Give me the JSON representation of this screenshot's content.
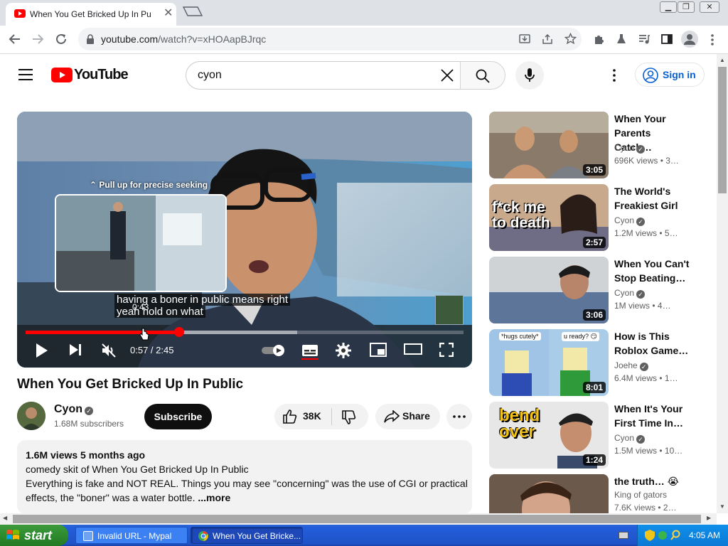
{
  "browser": {
    "tab_title": "When You Get Bricked Up In Public",
    "tab_close": "✕",
    "url_host": "youtube.com",
    "url_path": "/watch?v=xHOAapBJrqc"
  },
  "yt": {
    "logo_text": "YouTube",
    "search_value": "cyon",
    "signin_label": "Sign in"
  },
  "player": {
    "pull_up_hint": "Pull up for precise seeking",
    "subtitle_line1": "having a boner in public means right",
    "subtitle_line2": "yeah hold on what",
    "hover_time": "0:43",
    "time_display": "0:57 / 2:45",
    "progress": 0.35,
    "buffered": 0.62
  },
  "video": {
    "title": "When You Get Bricked Up In Public",
    "channel": "Cyon",
    "subscribers": "1.68M subscribers",
    "subscribe_label": "Subscribe",
    "likes": "38K",
    "share_label": "Share",
    "desc_stats": "1.6M views  5 months ago",
    "desc_line1": "comedy skit of When You Get Bricked Up In Public",
    "desc_line2": "Everything is fake and NOT REAL. Things you may see \"concerning\" was the use of CGI  or practical",
    "desc_line3": "effects, the \"boner\" was a water bottle.",
    "more_label": "...more"
  },
  "recommendations": [
    {
      "title": "When Your Parents Catch…",
      "channel": "Cyon",
      "views": "696K views",
      "age": "3…",
      "duration": "3:05",
      "verified": true,
      "thumb_text": ""
    },
    {
      "title": "The World's Freakiest Girl",
      "channel": "Cyon",
      "views": "1.2M views",
      "age": "5…",
      "duration": "2:57",
      "verified": true,
      "thumb_text": "f*ck me to death"
    },
    {
      "title": "When You Can't Stop Beating…",
      "channel": "Cyon",
      "views": "1M views",
      "age": "4…",
      "duration": "3:06",
      "verified": true,
      "thumb_text": ""
    },
    {
      "title": "How is This Roblox Game…",
      "channel": "Joehe",
      "views": "6.4M views",
      "age": "1…",
      "duration": "8:01",
      "verified": true,
      "thumb_text": "*hugs cutely*",
      "thumb_text2": "u ready? 😏"
    },
    {
      "title": "When It's Your First Time In…",
      "channel": "Cyon",
      "views": "1.5M views",
      "age": "10…",
      "duration": "1:24",
      "verified": true,
      "thumb_text": "bend over"
    },
    {
      "title": "the truth… 😭",
      "channel": "King of gators",
      "views": "7.6K views",
      "age": "2…",
      "duration": "",
      "verified": false,
      "thumb_text": ""
    }
  ],
  "taskbar": {
    "start_label": "start",
    "task1": "Invalid URL - Mypal",
    "task2": "When You Get Bricke...",
    "clock": "4:05 AM"
  },
  "colors": {
    "yt_red": "#ff0000",
    "link_blue": "#065fd4",
    "xp_blue": "#245edb",
    "xp_green": "#2e8b2e"
  }
}
